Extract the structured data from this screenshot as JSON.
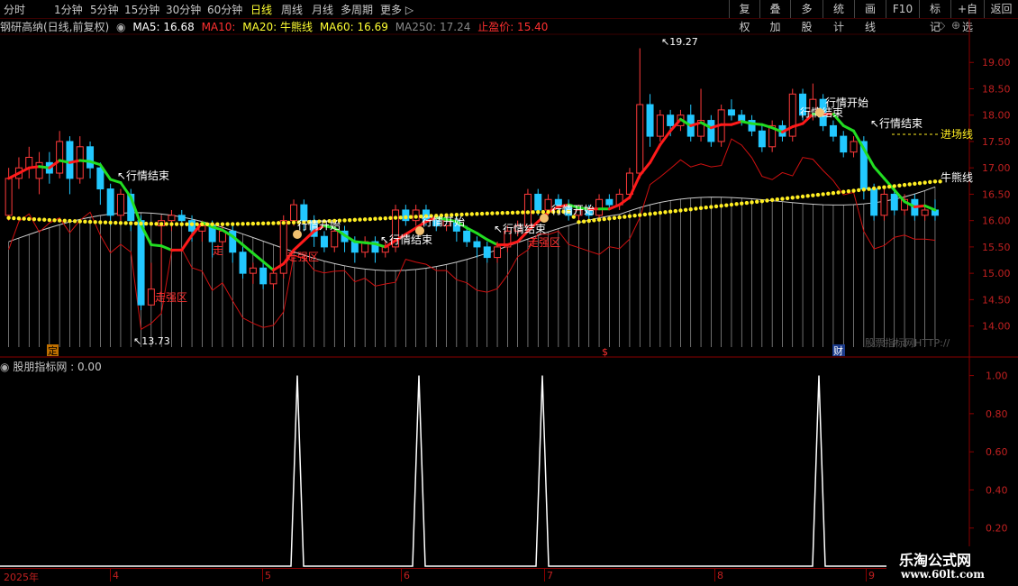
{
  "toolbar": {
    "left": [
      "分时",
      "1分钟",
      "5分钟",
      "15分钟",
      "30分钟",
      "60分钟",
      "日线",
      "周线",
      "月线",
      "多周期",
      "更多"
    ],
    "right": [
      "复权",
      "叠加",
      "多股",
      "统计",
      "画线",
      "F10",
      "标记",
      "+自选",
      "返回"
    ],
    "active": "日线"
  },
  "info": {
    "stock": "钢研高纳(日线,前复权)",
    "ma5": "MA5: 16.68",
    "ma10": "MA10:",
    "ma20": "MA20: 牛熊线",
    "ma60": "MA60: 16.69",
    "ma250": "MA250: 17.24",
    "stop": "止盈价: 15.40"
  },
  "price_axis": [
    "19.00",
    "18.50",
    "18.00",
    "17.50",
    "17.00",
    "16.50",
    "16.00",
    "15.50",
    "15.00",
    "14.50",
    "14.00"
  ],
  "sub_axis": [
    "1.00",
    "0.80",
    "0.60",
    "0.40",
    "0.20"
  ],
  "sub_title": "股朋指标网 : 0.00",
  "dates": [
    "2025年",
    "4",
    "5",
    "6",
    "7",
    "8",
    "9"
  ],
  "markers": {
    "ding": "定",
    "s": "$",
    "cai": "财"
  },
  "annotations": {
    "high": "19.27",
    "low": "13.73",
    "end": "行情结束",
    "start": "行情开始",
    "weak": "走强区",
    "entry": "进场线",
    "bull": "牛熊线"
  },
  "watermark": "股票指标网HTTP://",
  "logo": {
    "line1": "乐淘公式网",
    "line2": "www.60lt.com"
  },
  "chart_data": {
    "type": "candlestick",
    "ylim": [
      13.6,
      19.5
    ],
    "candles": [
      [
        16.1,
        16.8,
        16.0,
        17.0
      ],
      [
        16.8,
        17.0,
        16.6,
        17.2
      ],
      [
        17.0,
        17.2,
        16.8,
        17.4
      ],
      [
        16.8,
        17.1,
        16.5,
        17.3
      ],
      [
        17.1,
        16.9,
        16.7,
        17.3
      ],
      [
        16.9,
        17.5,
        16.8,
        17.7
      ],
      [
        17.5,
        16.8,
        16.5,
        17.6
      ],
      [
        16.8,
        17.4,
        16.7,
        17.6
      ],
      [
        17.4,
        17.0,
        16.8,
        17.5
      ],
      [
        17.0,
        16.6,
        16.3,
        17.1
      ],
      [
        16.6,
        16.1,
        15.9,
        16.7
      ],
      [
        16.1,
        16.5,
        16.0,
        16.6
      ],
      [
        16.5,
        16.0,
        15.8,
        16.6
      ],
      [
        16.0,
        14.4,
        14.3,
        16.1
      ],
      [
        14.4,
        14.7,
        14.4,
        15.2
      ],
      [
        15.9,
        16.0,
        14.6,
        16.1
      ],
      [
        16.0,
        16.1,
        15.8,
        16.2
      ],
      [
        16.1,
        16.0,
        15.9,
        16.2
      ],
      [
        16.0,
        15.8,
        15.6,
        16.1
      ],
      [
        15.8,
        15.9,
        15.6,
        16.0
      ],
      [
        15.9,
        15.6,
        15.3,
        16.0
      ],
      [
        15.6,
        15.8,
        15.5,
        15.9
      ],
      [
        15.8,
        15.4,
        15.2,
        15.9
      ],
      [
        15.4,
        15.0,
        14.9,
        15.5
      ],
      [
        15.0,
        15.1,
        14.8,
        15.2
      ],
      [
        15.1,
        14.8,
        14.7,
        15.2
      ],
      [
        14.8,
        15.0,
        14.7,
        15.1
      ],
      [
        15.0,
        16.0,
        14.9,
        16.1
      ],
      [
        16.0,
        16.3,
        15.9,
        16.4
      ],
      [
        16.3,
        16.0,
        15.8,
        16.4
      ],
      [
        16.0,
        15.7,
        15.5,
        16.1
      ],
      [
        15.7,
        15.5,
        15.4,
        15.8
      ],
      [
        15.5,
        15.8,
        15.4,
        15.9
      ],
      [
        15.8,
        15.6,
        15.4,
        15.9
      ],
      [
        15.6,
        15.4,
        15.2,
        15.7
      ],
      [
        15.4,
        15.6,
        15.3,
        15.7
      ],
      [
        15.6,
        15.4,
        15.2,
        15.7
      ],
      [
        15.4,
        15.5,
        15.3,
        15.6
      ],
      [
        15.5,
        16.2,
        15.4,
        16.3
      ],
      [
        16.2,
        16.0,
        15.9,
        16.3
      ],
      [
        16.0,
        16.2,
        15.9,
        16.3
      ],
      [
        16.2,
        16.0,
        15.9,
        16.3
      ],
      [
        16.0,
        15.9,
        15.8,
        16.1
      ],
      [
        15.9,
        16.0,
        15.8,
        16.1
      ],
      [
        16.0,
        15.8,
        15.6,
        16.1
      ],
      [
        15.8,
        15.6,
        15.5,
        15.9
      ],
      [
        15.6,
        15.5,
        15.3,
        15.7
      ],
      [
        15.5,
        15.3,
        15.2,
        15.6
      ],
      [
        15.3,
        15.5,
        15.2,
        15.6
      ],
      [
        15.5,
        15.8,
        15.4,
        15.9
      ],
      [
        15.8,
        15.9,
        15.7,
        16.0
      ],
      [
        15.9,
        16.5,
        15.8,
        16.6
      ],
      [
        16.5,
        16.2,
        16.1,
        16.6
      ],
      [
        16.2,
        16.4,
        16.1,
        16.5
      ],
      [
        16.4,
        16.3,
        16.2,
        16.5
      ],
      [
        16.3,
        16.1,
        16.0,
        16.4
      ],
      [
        16.1,
        16.2,
        16.0,
        16.3
      ],
      [
        16.2,
        16.1,
        16.0,
        16.3
      ],
      [
        16.1,
        16.4,
        16.0,
        16.5
      ],
      [
        16.4,
        16.3,
        16.2,
        16.5
      ],
      [
        16.3,
        16.5,
        16.2,
        16.6
      ],
      [
        16.5,
        16.9,
        16.4,
        17.0
      ],
      [
        16.9,
        18.2,
        16.8,
        19.27
      ],
      [
        18.2,
        17.6,
        17.4,
        18.4
      ],
      [
        17.6,
        18.0,
        17.5,
        18.1
      ],
      [
        18.0,
        17.8,
        17.6,
        18.1
      ],
      [
        17.8,
        18.0,
        17.7,
        18.1
      ],
      [
        18.0,
        17.6,
        17.5,
        18.2
      ],
      [
        17.6,
        17.9,
        17.5,
        18.5
      ],
      [
        17.9,
        17.5,
        17.4,
        18.0
      ],
      [
        17.5,
        18.1,
        17.4,
        18.2
      ],
      [
        18.1,
        18.0,
        17.9,
        18.3
      ],
      [
        18.0,
        17.9,
        17.8,
        18.1
      ],
      [
        17.9,
        17.7,
        17.6,
        18.0
      ],
      [
        17.7,
        17.4,
        17.3,
        17.8
      ],
      [
        17.4,
        17.8,
        17.3,
        17.9
      ],
      [
        17.8,
        17.6,
        17.5,
        17.9
      ],
      [
        17.6,
        18.4,
        17.5,
        18.5
      ],
      [
        18.4,
        18.0,
        17.9,
        18.5
      ],
      [
        18.0,
        18.3,
        17.9,
        18.6
      ],
      [
        18.3,
        17.8,
        17.7,
        18.4
      ],
      [
        17.8,
        17.6,
        17.5,
        17.9
      ],
      [
        17.6,
        17.3,
        17.2,
        17.7
      ],
      [
        17.3,
        17.5,
        17.2,
        17.6
      ],
      [
        17.5,
        16.6,
        16.4,
        17.6
      ],
      [
        16.6,
        16.1,
        16.0,
        16.7
      ],
      [
        16.1,
        16.5,
        16.0,
        16.6
      ],
      [
        16.5,
        16.2,
        16.1,
        16.6
      ],
      [
        16.2,
        16.4,
        16.1,
        16.5
      ],
      [
        16.4,
        16.1,
        16.0,
        16.5
      ],
      [
        16.1,
        16.2,
        16.0,
        16.3
      ],
      [
        16.2,
        16.1,
        16.0,
        16.4
      ]
    ],
    "peaks": [
      0.05,
      0.23,
      0.4,
      0.72
    ]
  }
}
